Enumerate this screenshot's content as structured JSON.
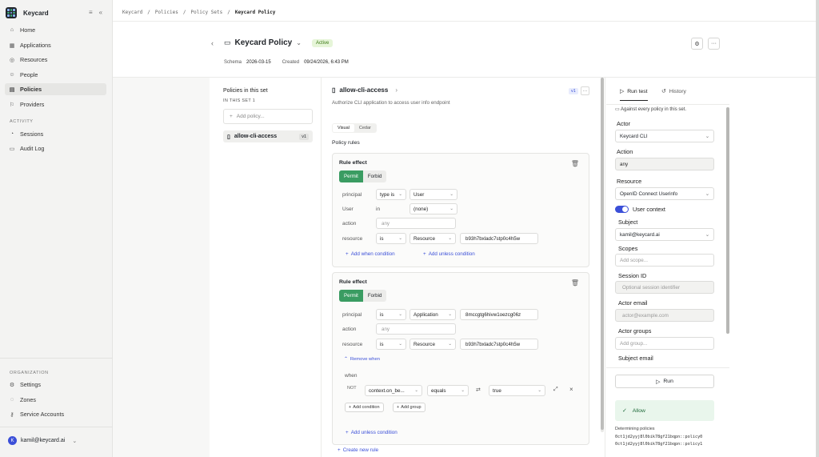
{
  "sidebar": {
    "brand": "Keycard",
    "nav": [
      {
        "label": "Home",
        "icon": "home-icon"
      },
      {
        "label": "Applications",
        "icon": "applications-icon"
      },
      {
        "label": "Resources",
        "icon": "resources-icon"
      },
      {
        "label": "People",
        "icon": "people-icon"
      },
      {
        "label": "Policies",
        "icon": "policies-icon",
        "active": true
      },
      {
        "label": "Providers",
        "icon": "providers-icon"
      }
    ],
    "activity_label": "ACTIVITY",
    "activity": [
      {
        "label": "Sessions",
        "icon": "sessions-icon"
      },
      {
        "label": "Audit Log",
        "icon": "audit-log-icon"
      }
    ],
    "organization_label": "ORGANIZATION",
    "organization": [
      {
        "label": "Settings",
        "icon": "settings-icon"
      },
      {
        "label": "Zones",
        "icon": "zones-icon"
      },
      {
        "label": "Service Accounts",
        "icon": "service-accounts-icon"
      }
    ],
    "user": {
      "initial": "K",
      "email": "kamil@keycard.ai"
    }
  },
  "breadcrumb": [
    "Keycard",
    "Policies",
    "Policy Sets",
    "Keycard Policy"
  ],
  "header": {
    "title": "Keycard Policy",
    "status": "Active",
    "schema_label": "Schema",
    "schema_value": "2026-03-15",
    "created_label": "Created",
    "created_value": "09/24/2026, 6:43 PM"
  },
  "policies_panel": {
    "title": "Policies in this set",
    "subtitle": "IN THIS SET 1",
    "add_placeholder": "Add policy...",
    "items": [
      {
        "name": "allow-cli-access",
        "version": "v1"
      }
    ]
  },
  "editor": {
    "policy_name": "allow-cli-access",
    "version": "v1",
    "description": "Authorize CLI application to access user info endpoint",
    "tabs": [
      "Visual",
      "Cedar"
    ],
    "active_tab": "Visual",
    "section_title": "Policy rules",
    "rules": [
      {
        "title": "Rule effect",
        "permit": "Permit",
        "forbid": "Forbid",
        "principal": {
          "label": "principal",
          "op": "type is",
          "value": "User"
        },
        "user": {
          "label": "User",
          "op": "in",
          "value": "(none)"
        },
        "action": {
          "label": "action",
          "placeholder": "any"
        },
        "resource": {
          "label": "resource",
          "op": "is",
          "type": "Resource",
          "value": "b93h7bxladc7stp0c4h5w"
        },
        "add_when": "Add when condition",
        "add_unless": "Add unless condition"
      },
      {
        "title": "Rule effect",
        "permit": "Permit",
        "forbid": "Forbid",
        "principal": {
          "label": "principal",
          "op": "is",
          "type": "Application",
          "value": "8mccgtg6hivw1oezcg06z"
        },
        "action": {
          "label": "action",
          "placeholder": "any"
        },
        "resource": {
          "label": "resource",
          "op": "is",
          "type": "Resource",
          "value": "b93h7bxladc7stp0c4h5w"
        },
        "remove_when": "Remove when",
        "when_label": "when",
        "not_label": "NOT",
        "condition": {
          "field": "context.on_be...",
          "op": "equals",
          "value": "true"
        },
        "add_condition": "Add condition",
        "add_group": "Add group",
        "add_unless": "Add unless condition"
      }
    ],
    "create_rule": "Create new rule"
  },
  "run_panel": {
    "tabs": [
      "Run test",
      "History"
    ],
    "note": "Against every policy in this set.",
    "actor_label": "Actor",
    "actor_value": "Keycard CLI",
    "action_label": "Action",
    "action_value": "any",
    "resource_label": "Resource",
    "resource_value": "OpenID Connect Userinfo",
    "user_context_label": "User context",
    "user_context_on": true,
    "subject_label": "Subject",
    "subject_value": "kamil@keycard.ai",
    "scopes_label": "Scopes",
    "scopes_placeholder": "Add scope...",
    "session_label": "Session ID",
    "session_placeholder": "Optional session identifier",
    "actor_email_label": "Actor email",
    "actor_email_placeholder": "actor@example.com",
    "actor_groups_label": "Actor groups",
    "actor_groups_placeholder": "Add group...",
    "subject_email_label": "Subject email",
    "run_label": "Run",
    "result": "Allow",
    "determining_label": "Determining policies",
    "determining": [
      "0ct1jd2yyj8l0bik78gf21bqpn::policy0",
      "0ct1jd2yyj8l0bik78gf21bqpn::policy1"
    ]
  },
  "colors": {
    "accent": "#3b4fd8",
    "permit": "#3a9c62",
    "active_badge": "#e6f5d8",
    "allow_bg": "#e9f6ec"
  }
}
